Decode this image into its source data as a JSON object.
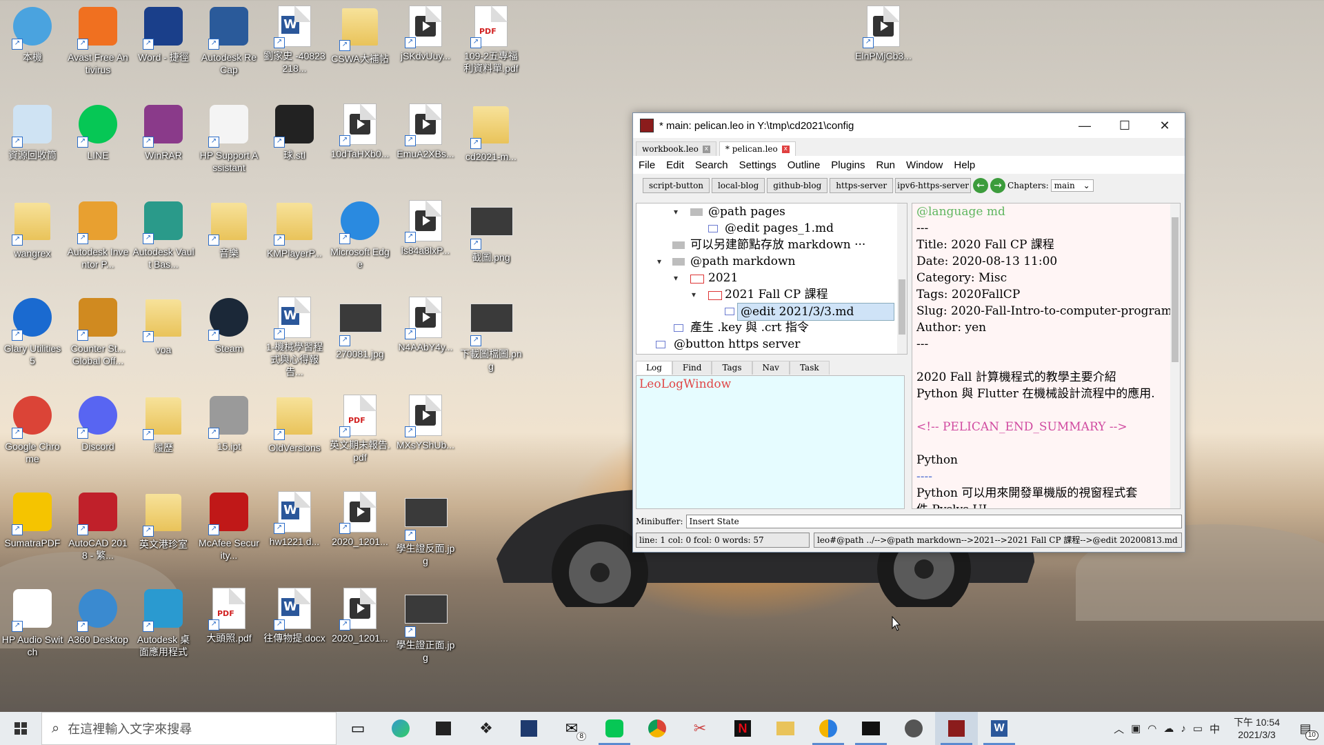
{
  "desktop": {
    "icons": [
      {
        "label": "本機",
        "name": "this-pc-icon"
      },
      {
        "label": "Avast Free Antivirus",
        "name": "avast-icon"
      },
      {
        "label": "Word - 捷徑",
        "name": "word-shortcut-icon"
      },
      {
        "label": "Autodesk ReCap",
        "name": "recap-icon"
      },
      {
        "label": "劉家史 -40823218...",
        "name": "word-doc-icon"
      },
      {
        "label": "CSWA大補帖",
        "name": "folder-icon"
      },
      {
        "label": "jSKdvUuy...",
        "name": "video-icon"
      },
      {
        "label": "109-2五專福利資料單.pdf",
        "name": "pdf-icon"
      },
      {
        "label": "ElnPMjCb3...",
        "name": "video-icon"
      },
      {
        "label": "資源回收筒",
        "name": "recycle-bin-icon"
      },
      {
        "label": "LINE",
        "name": "line-icon"
      },
      {
        "label": "WinRAR",
        "name": "winrar-icon"
      },
      {
        "label": "HP Support Assistant",
        "name": "hp-support-icon"
      },
      {
        "label": "球.stl",
        "name": "stl-icon"
      },
      {
        "label": "10dTaHXb0...",
        "name": "video-icon"
      },
      {
        "label": "EmuA2XBs...",
        "name": "video-icon"
      },
      {
        "label": "cd2021-m...",
        "name": "folder-icon"
      },
      {
        "label": "wangrex",
        "name": "user-folder-icon"
      },
      {
        "label": "Autodesk Inventor P...",
        "name": "inventor-icon"
      },
      {
        "label": "Autodesk Vault Bas...",
        "name": "vault-icon"
      },
      {
        "label": "音樂",
        "name": "music-folder-icon"
      },
      {
        "label": "KMPlayerP...",
        "name": "folder-icon"
      },
      {
        "label": "Microsoft Edge",
        "name": "edge-icon"
      },
      {
        "label": "ls84a8lxP...",
        "name": "video-icon"
      },
      {
        "label": "截圖.png",
        "name": "image-icon"
      },
      {
        "label": "Glary Utilities 5",
        "name": "glary-icon"
      },
      {
        "label": "Counter St... Global Off...",
        "name": "csgo-icon"
      },
      {
        "label": "voa",
        "name": "folder-icon"
      },
      {
        "label": "Steam",
        "name": "steam-icon"
      },
      {
        "label": "1-機械學習程式與心得報告...",
        "name": "word-doc-icon"
      },
      {
        "label": "270081.jpg",
        "name": "image-icon"
      },
      {
        "label": "N4AAbY4y...",
        "name": "video-icon"
      },
      {
        "label": "下載圖檔圖.png",
        "name": "image-icon"
      },
      {
        "label": "Google Chrome",
        "name": "chrome-icon"
      },
      {
        "label": "Discord",
        "name": "discord-icon"
      },
      {
        "label": "履歷",
        "name": "folder-icon"
      },
      {
        "label": "15.ipt",
        "name": "ipt-icon"
      },
      {
        "label": "OldVersions",
        "name": "folder-icon"
      },
      {
        "label": "英文期末報告.pdf",
        "name": "pdf-icon"
      },
      {
        "label": "MXsYShUb...",
        "name": "video-icon"
      },
      {
        "label": "SumatraPDF",
        "name": "sumatra-icon"
      },
      {
        "label": "AutoCAD 2018 - 繁...",
        "name": "autocad-icon"
      },
      {
        "label": "英文港珍室",
        "name": "folder-icon"
      },
      {
        "label": "McAfee Security...",
        "name": "mcafee-icon"
      },
      {
        "label": "hw1221.d...",
        "name": "word-doc-icon"
      },
      {
        "label": "2020_1201...",
        "name": "video-icon"
      },
      {
        "label": "學生證反面.jpg",
        "name": "image-icon"
      },
      {
        "label": "HP Audio Switch",
        "name": "hp-audio-icon"
      },
      {
        "label": "A360 Desktop",
        "name": "a360-icon"
      },
      {
        "label": "Autodesk 桌面應用程式",
        "name": "autodesk-app-icon"
      },
      {
        "label": "大頭照.pdf",
        "name": "pdf-icon"
      },
      {
        "label": "往傳物提.docx",
        "name": "word-doc-icon"
      },
      {
        "label": "2020_1201...",
        "name": "video-icon"
      },
      {
        "label": "學生證正面.jpg",
        "name": "image-icon"
      }
    ]
  },
  "window": {
    "title": "* main: pelican.leo in Y:\\tmp\\cd2021\\config",
    "minimize": "—",
    "maximize": "☐",
    "close": "✕",
    "tabs": [
      {
        "label": "workbook.leo",
        "close": "x"
      },
      {
        "label": "* pelican.leo",
        "close": "x"
      }
    ],
    "menu": [
      "File",
      "Edit",
      "Search",
      "Settings",
      "Outline",
      "Plugins",
      "Run",
      "Window",
      "Help"
    ],
    "toolbar": {
      "buttons": [
        "script-button",
        "local-blog",
        "github-blog",
        "https-server",
        "ipv6-https-server"
      ],
      "back": "←",
      "forward": "→",
      "chapters_label": "Chapters:",
      "chapter_value": "main"
    },
    "outline": [
      {
        "text": "@path pages",
        "tri": "▾"
      },
      {
        "text": "@edit pages_1.md",
        "tri": ""
      },
      {
        "text": "可以另建節點存放 markdown ···",
        "tri": ""
      },
      {
        "text": "@path markdown",
        "tri": "▾"
      },
      {
        "text": "2021",
        "tri": "▾"
      },
      {
        "text": "2021 Fall CP 課程",
        "tri": "▾"
      },
      {
        "text": "@edit 2021/3/3.md",
        "tri": ""
      },
      {
        "text": "產生 .key 與 .crt 指令",
        "tri": ""
      },
      {
        "text": "@button https server",
        "tri": ""
      }
    ],
    "log_tabs": [
      "Log",
      "Find",
      "Tags",
      "Nav",
      "Task"
    ],
    "log_text": "LeoLogWindow",
    "body_lines": [
      "@language md",
      "---",
      "Title: 2020 Fall CP 課程",
      "Date: 2020-08-13 11:00",
      "Category: Misc",
      "Tags: 2020FallCP",
      "Slug: 2020-Fall-Intro-to-computer-programming",
      "Author: yen",
      "---",
      "",
      "2020 Fall 計算機程式的教學主要介紹",
      "Python 與 Flutter 在機械設計流程中的應用.",
      "",
      "<!-- PELICAN_END_SUMMARY -->",
      "",
      "Python",
      "----",
      "Python 可以用來開發單機版的視窗程式套",
      "件 Pyslys UI"
    ],
    "minibuffer_label": "Minibuffer:",
    "minibuffer_value": "Insert State",
    "status_left": "line: 1 col: 0  fcol: 0 words: 57",
    "status_right": "leo#@path ../-->@path markdown-->2021-->2021 Fall CP 課程-->@edit 20200813.md"
  },
  "taskbar": {
    "search_placeholder": "在這裡輸入文字來搜尋",
    "mail_badge": "8",
    "ime": "中",
    "time": "下午 10:54",
    "date": "2021/3/3",
    "notifications": "10"
  },
  "colors": {
    "accent": "#2b579a",
    "log_text": "#e04646",
    "body_bg": "#fff5f5",
    "log_bg": "#e6fcff"
  }
}
